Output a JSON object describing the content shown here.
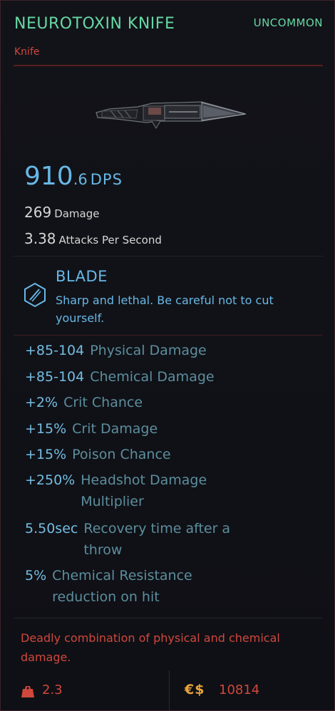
{
  "item": {
    "name": "NEUROTOXIN KNIFE",
    "rarity": "UNCOMMON",
    "type": "Knife",
    "image_icon": "knife-icon"
  },
  "stats": {
    "dps_whole": "910",
    "dps_decimal": ".6",
    "dps_unit": "DPS",
    "damage_value": "269",
    "damage_label": "Damage",
    "aps_value": "3.38",
    "aps_label": "Attacks Per Second"
  },
  "mod": {
    "icon": "blade-icon",
    "title": "BLADE",
    "description": "Sharp and lethal. Be careful not to cut yourself."
  },
  "modifiers": [
    {
      "value": "+85-104",
      "label": "Physical Damage"
    },
    {
      "value": "+85-104",
      "label": "Chemical Damage"
    },
    {
      "value": "+2%",
      "label": "Crit Chance"
    },
    {
      "value": "+15%",
      "label": "Crit Damage"
    },
    {
      "value": "+15%",
      "label": "Poison Chance"
    },
    {
      "value": "+250%",
      "label": "Headshot Damage Multiplier"
    },
    {
      "value": "5.50sec",
      "label": "Recovery time after a throw"
    },
    {
      "value": "5%",
      "label": "Chemical Resistance reduction on hit"
    }
  ],
  "flavor_text": "Deadly combination of physical and chemical damage.",
  "footer": {
    "weight_icon": "weight-icon",
    "weight": "2.3",
    "currency_symbol": "€$",
    "price": "10814"
  },
  "colors": {
    "rarity_green": "#67d8a3",
    "stat_blue": "#67b8e6",
    "accent_red": "#d0473c",
    "currency_gold": "#e8a53c",
    "background": "#0e0f14"
  }
}
